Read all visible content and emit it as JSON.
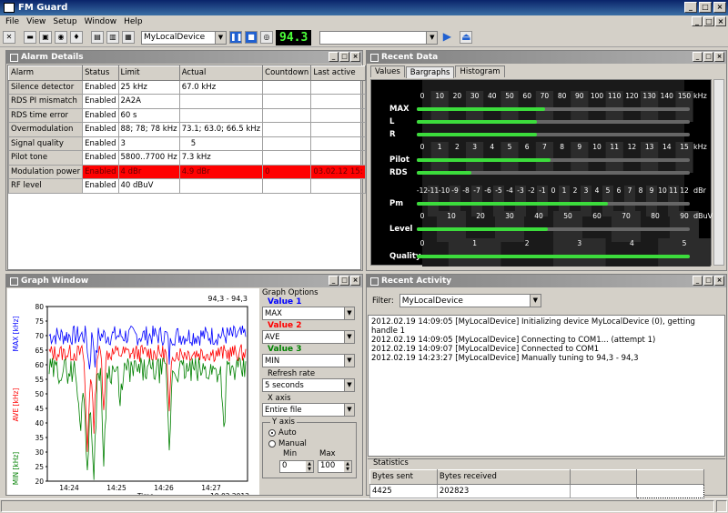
{
  "app": {
    "title": "FM Guard"
  },
  "menu": [
    "File",
    "View",
    "Setup",
    "Window",
    "Help"
  ],
  "toolbar": {
    "device": "MyLocalDevice",
    "frequency": "94.3",
    "rds_value": ""
  },
  "alarm": {
    "title": "Alarm Details",
    "headers": [
      "Alarm",
      "Status",
      "Limit",
      "Actual",
      "Countdown",
      "Last active"
    ],
    "rows": [
      {
        "alarm": "Silence detector",
        "status": "Enabled",
        "limit": "25 kHz",
        "actual": "67.0 kHz",
        "countdown": "",
        "last": ""
      },
      {
        "alarm": "RDS PI mismatch",
        "status": "Enabled",
        "limit": "2A2A",
        "actual": "",
        "countdown": "",
        "last": ""
      },
      {
        "alarm": "RDS time error",
        "status": "Enabled",
        "limit": "60 s",
        "actual": "",
        "countdown": "",
        "last": ""
      },
      {
        "alarm": "Overmodulation",
        "status": "Enabled",
        "limit": "88; 78; 78 kHz",
        "actual": "73.1; 63.0; 66.5 kHz",
        "countdown": "",
        "last": ""
      },
      {
        "alarm": "Signal quality",
        "status": "Enabled",
        "limit": "3",
        "actual": "5",
        "countdown": "",
        "last": ""
      },
      {
        "alarm": "Pilot tone",
        "status": "Enabled",
        "limit": "5800..7700 Hz",
        "actual": "7.3 kHz",
        "countdown": "",
        "last": ""
      },
      {
        "alarm": "Modulation power",
        "status": "Enabled",
        "limit": "4 dBr",
        "actual": "4.9 dBr",
        "countdown": "0",
        "last": "03.02.12 15:"
      },
      {
        "alarm": "RF level",
        "status": "Enabled",
        "limit": "40 dBuV",
        "actual": "",
        "countdown": "",
        "last": ""
      }
    ]
  },
  "recent": {
    "title": "Recent Data",
    "tabs": [
      "Values",
      "Bargraphs",
      "Histogram"
    ],
    "scale_khz": [
      "0",
      "10",
      "20",
      "30",
      "40",
      "50",
      "60",
      "70",
      "80",
      "90",
      "100",
      "110",
      "120",
      "130",
      "140",
      "150"
    ],
    "unit_khz": "kHz",
    "scale_pilot": [
      "0",
      "1",
      "2",
      "3",
      "4",
      "5",
      "6",
      "7",
      "8",
      "9",
      "10",
      "11",
      "12",
      "13",
      "14",
      "15"
    ],
    "scale_dbr": [
      "-12",
      "-11",
      "-10",
      "-9",
      "-8",
      "-7",
      "-6",
      "-5",
      "-4",
      "-3",
      "-2",
      "-1",
      "0",
      "1",
      "2",
      "3",
      "4",
      "5",
      "6",
      "7",
      "8",
      "9",
      "10",
      "11",
      "12"
    ],
    "unit_dbr": "dBr",
    "scale_level": [
      "0",
      "10",
      "20",
      "30",
      "40",
      "50",
      "60",
      "70",
      "80",
      "90"
    ],
    "unit_level": "dBuV",
    "scale_quality": [
      "0",
      "1",
      "2",
      "3",
      "4",
      "5"
    ],
    "labels": {
      "max": "MAX",
      "l": "L",
      "r": "R",
      "pilot": "Pilot",
      "rds": "RDS",
      "pm": "Pm",
      "level": "Level",
      "quality": "Quality"
    },
    "values": {
      "max": 0.47,
      "l": 0.44,
      "r": 0.44,
      "pilot": 0.49,
      "rds": 0.2,
      "pm": 0.7,
      "level": 0.48,
      "quality": 1.0
    }
  },
  "graph": {
    "title": "Graph Window",
    "freq": "94,3 - 94,3",
    "y_ticks": [
      "80",
      "75",
      "70",
      "65",
      "60",
      "55",
      "50",
      "45",
      "40",
      "35",
      "30",
      "25",
      "20"
    ],
    "x_ticks": [
      "14:24",
      "14:25",
      "14:26",
      "14:27"
    ],
    "xlabel": "Time",
    "date": "19.02.2012",
    "ylabels": {
      "max": "MAX [kHz]",
      "ave": "AVE [kHz]",
      "min": "MIN [kHz]"
    },
    "colors": {
      "max": "#0000ff",
      "ave": "#ff0000",
      "min": "#008000"
    }
  },
  "graph_options": {
    "title": "Graph Options",
    "value1": "Value 1",
    "value1_sel": "MAX",
    "value2": "Value 2",
    "value2_sel": "AVE",
    "value3": "Value 3",
    "value3_sel": "MIN",
    "refresh_lbl": "Refresh rate",
    "refresh_sel": "5 seconds",
    "xaxis_lbl": "X axis",
    "xaxis_sel": "Entire file",
    "yaxis_lbl": "Y axis",
    "auto": "Auto",
    "manual": "Manual",
    "min_lbl": "Min",
    "max_lbl": "Max",
    "min_val": "0",
    "max_val": "100"
  },
  "activity": {
    "title": "Recent Activity",
    "filter_lbl": "Filter:",
    "filter_sel": "MyLocalDevice",
    "log": [
      "2012.02.19 14:09:05 [MyLocalDevice] Initializing device MyLocalDevice (0), getting handle 1",
      "2012.02.19 14:09:05 [MyLocalDevice] Connecting to COM1... (attempt 1)",
      "2012.02.19 14:09:07 [MyLocalDevice] Connected to COM1",
      "2012.02.19 14:23:27 [MyLocalDevice] Manually tuning to 94,3 - 94,3"
    ],
    "stats_title": "Statistics",
    "bytes_sent_lbl": "Bytes sent",
    "bytes_recv_lbl": "Bytes received",
    "bytes_sent": "4425",
    "bytes_recv": "202823"
  }
}
